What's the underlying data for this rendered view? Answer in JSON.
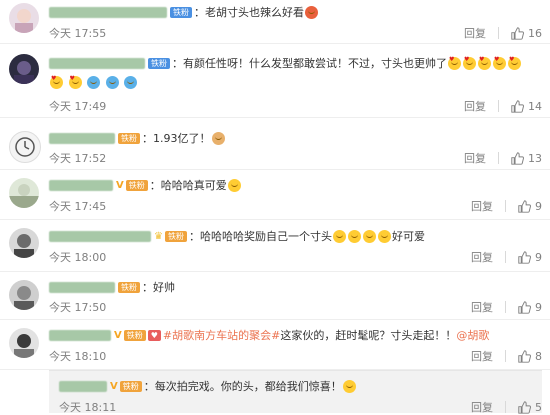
{
  "comments": [
    {
      "badge": "铁粉",
      "text": "：老胡寸头也辣么好看",
      "time": "今天 17:55",
      "reply": "回复",
      "likes": "16"
    },
    {
      "badge": "铁粉",
      "text": "：有颜任性呀！什么发型都敢尝试！不过，寸头也更帅了",
      "time": "今天 17:49",
      "reply": "回复",
      "likes": "14"
    },
    {
      "badge": "铁粉",
      "text": "：1.93亿了！",
      "time": "今天 17:52",
      "reply": "回复",
      "likes": "13"
    },
    {
      "badge": "铁粉",
      "text": "：哈哈哈真可爱",
      "time": "今天 17:45",
      "reply": "回复",
      "likes": "9"
    },
    {
      "badge": "铁粉",
      "text": "：哈哈哈哈奖励自己一个寸头",
      "text_after": "好可爱",
      "time": "今天 18:00",
      "reply": "回复",
      "likes": "9"
    },
    {
      "badge": "铁粉",
      "text": "：好帅",
      "time": "今天 17:50",
      "reply": "回复",
      "likes": "9"
    },
    {
      "badge": "铁粉",
      "topic": "#胡歌南方车站的聚会#",
      "text": " 这家伙的，赶时髦呢？寸头走起！！",
      "mention": "@胡歌",
      "time": "今天 18:10",
      "reply": "回复",
      "likes": "8"
    },
    {
      "badge": "铁粉",
      "text": "：每次拍完戏。你的头，都给我们惊喜！",
      "time": "今天 18:11",
      "reply": "回复",
      "likes": "5"
    }
  ],
  "colors": {
    "link": "#eb7350",
    "muted": "#808080",
    "iron_badge": "#f0a33c",
    "blue_badge": "#4a90e2"
  },
  "icons": {
    "like": "thumbs-up-icon"
  }
}
